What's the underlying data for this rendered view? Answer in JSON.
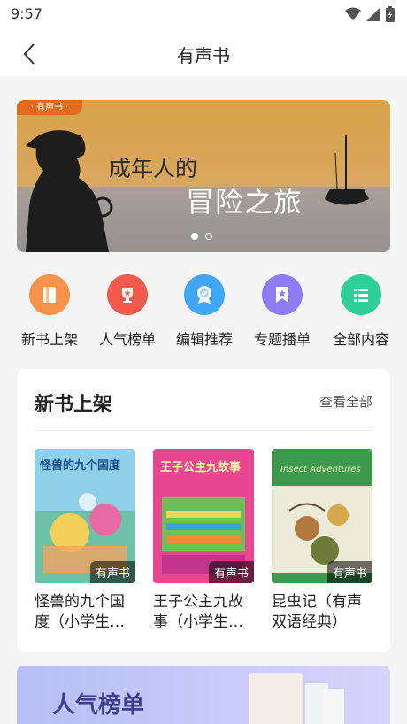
{
  "status": {
    "time": "9:57"
  },
  "nav": {
    "title": "有声书"
  },
  "banner": {
    "tag": "· 有声书 ·",
    "line1": "成年人的",
    "line2": "冒险之旅"
  },
  "categories": [
    {
      "label": "新书上架",
      "icon": "book-icon",
      "color": "#f7924a"
    },
    {
      "label": "人气榜单",
      "icon": "trophy-icon",
      "color": "#f2594c"
    },
    {
      "label": "编辑推荐",
      "icon": "medal-icon",
      "color": "#3fa7f5"
    },
    {
      "label": "专题播单",
      "icon": "bookmark-star-icon",
      "color": "#8f7cf2"
    },
    {
      "label": "全部内容",
      "icon": "list-icon",
      "color": "#2fcf9a"
    }
  ],
  "new_books": {
    "title": "新书上架",
    "more": "查看全部",
    "badge": "有声书",
    "books": [
      {
        "title": "怪兽的九个国度（小学生…",
        "cover_title": "怪兽的九个国度"
      },
      {
        "title": "王子公主九故事（小学生…",
        "cover_title": "王子公主九故事"
      },
      {
        "title": "昆虫记（有声双语经典）",
        "cover_title": "Insect Adventures"
      }
    ]
  },
  "ranking": {
    "title": "人气榜单"
  },
  "colors": {
    "accent": "#e06a1e",
    "background": "#f5f5f5"
  }
}
